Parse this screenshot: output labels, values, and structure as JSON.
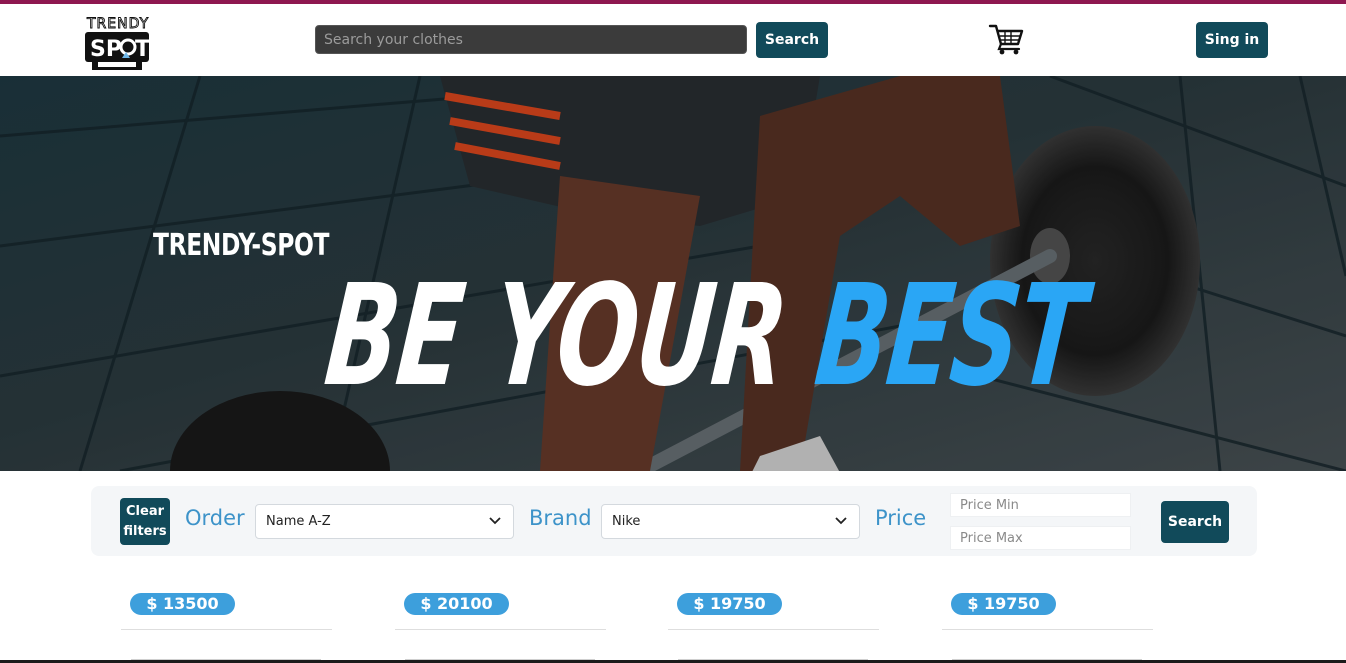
{
  "header": {
    "logo_text": "TRENDY SPOT",
    "search_placeholder": "Search your clothes",
    "search_button": "Search",
    "cart_icon": "cart-icon",
    "signin_button": "Sing in"
  },
  "hero": {
    "brand": "TRENDY-SPOT",
    "slogan_white": "BE YOUR ",
    "slogan_blue": "BEST"
  },
  "filters": {
    "clear_button": "Clear filters",
    "order_label": "Order",
    "order_value": "Name A-Z",
    "brand_label": "Brand",
    "brand_value": "Nike",
    "price_label": "Price",
    "price_min_placeholder": "Price Min",
    "price_max_placeholder": "Price Max",
    "search_button": "Search"
  },
  "products": [
    {
      "price": "$ 13500"
    },
    {
      "price": "$ 20100"
    },
    {
      "price": "$ 19750"
    },
    {
      "price": "$ 19750"
    }
  ],
  "colors": {
    "accent_top": "#8e1850",
    "button_dark": "#114a5a",
    "label_blue": "#3d93c9",
    "badge_blue": "#3d9fdc",
    "slogan_blue": "#2aa6f5"
  }
}
